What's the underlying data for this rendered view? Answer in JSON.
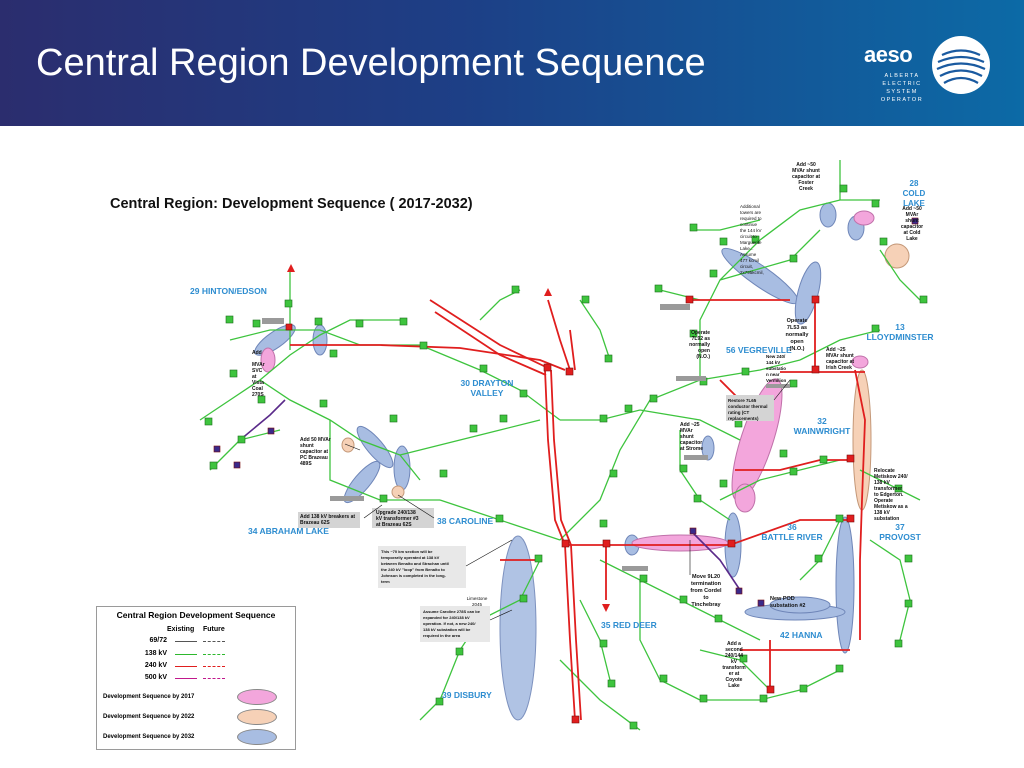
{
  "slide": {
    "title": "Central Region Development Sequence"
  },
  "logo": {
    "word": "aeso",
    "tagline": "ALBERTA ELECTRIC SYSTEM OPERATOR"
  },
  "diagram": {
    "title": "Central Region: Development Sequence ( 2017-2032)",
    "areas": [
      {
        "id": "28",
        "label": "28 COLD LAKE"
      },
      {
        "id": "29",
        "label": "29 HINTON/EDSON"
      },
      {
        "id": "30",
        "label": "30 DRAYTON VALLEY"
      },
      {
        "id": "13",
        "label": "13 LLOYDMINSTER"
      },
      {
        "id": "56",
        "label": "56 VEGREVILLE"
      },
      {
        "id": "32",
        "label": "32 WAINWRIGHT"
      },
      {
        "id": "34",
        "label": "34 ABRAHAM LAKE"
      },
      {
        "id": "38",
        "label": "38 CAROLINE"
      },
      {
        "id": "36",
        "label": "36 BATTLE RIVER"
      },
      {
        "id": "37",
        "label": "37 PROVOST"
      },
      {
        "id": "35",
        "label": "35 RED DEER"
      },
      {
        "id": "42",
        "label": "42 HANNA"
      },
      {
        "id": "39",
        "label": "39 DISBURY"
      }
    ],
    "annotations": {
      "foster_creek": "Add ~50 MVAr shunt capacitor at Foster Creek",
      "towers": "Additional towers are required to continue the 144 kV circuit to Marguerite Lake... Assume 477 kcmil, 2x795kcmil",
      "cold_lake_cap": "Add ~50 MVAr shunt capacitor at Cold Lake",
      "operate_7l53": "Operate 7L53 as normally open (N.O.)",
      "operate_7l92": "Operate 7L92 as normally open (N.O.)",
      "add_25_mvar": "Add ~25 MVAr shunt capacitor at Irish Creek",
      "new_substation": "New 240/144 kV substation near Vermilion",
      "restore_7l65": "Restore 7L65 conductor thermal rating (CT replacements)",
      "strome_cap": "Add ~25 MVAr shunt capacitor at Strome",
      "svc_vista": "Add MVAr SVC at Vista Coal 270S",
      "brazeau_cap": "Add 50 MVAr shunt capacitor at PC Brazeau 489S",
      "brazeau_breakers": "Add 138 kV breakers at Brazeau 62S",
      "brazeau_tx": "Upgrade 240/138 kV transformer #3 at Brazeau 62S",
      "metiskow": "Relocate Metiskow 240/138 kV transformer to Edgerton. Operate Metiskow as a 138 kV substation",
      "section_70km": "This ~70 km section will be temporarily operated at 138 kV between Benalto and Strachan until the 240 kV \"loop\" from Benalto to Johnson is completed in the long-term",
      "caroline_27": "Assume Caroline 278S can be expanded for 240/138 kV operation. If not, a new 240/138 kV substation will be required in the area",
      "limestone": "Limestone 2045",
      "cordel": "Move 9L20 termination from Cordel to Tinchebray",
      "pod_hanna": "New POD substation #2",
      "coyote_lake": "Add a second 240/144 kV transformer at Coyote Lake"
    }
  },
  "legend": {
    "title": "Central Region Development Sequence",
    "col_existing": "Existing",
    "col_future": "Future",
    "rows": [
      {
        "label": "69/72",
        "color": "#555555"
      },
      {
        "label": "138 kV",
        "color": "#2db82d"
      },
      {
        "label": "240 kV",
        "color": "#e01e1e"
      },
      {
        "label": "500 kV",
        "color": "#c0188c"
      }
    ],
    "sequences": [
      {
        "label": "Development Sequence by 2017",
        "color": "#f3a6dc"
      },
      {
        "label": "Development Sequence by 2022",
        "color": "#f6d1b7"
      },
      {
        "label": "Development Sequence by 2032",
        "color": "#a8bde2"
      }
    ]
  }
}
